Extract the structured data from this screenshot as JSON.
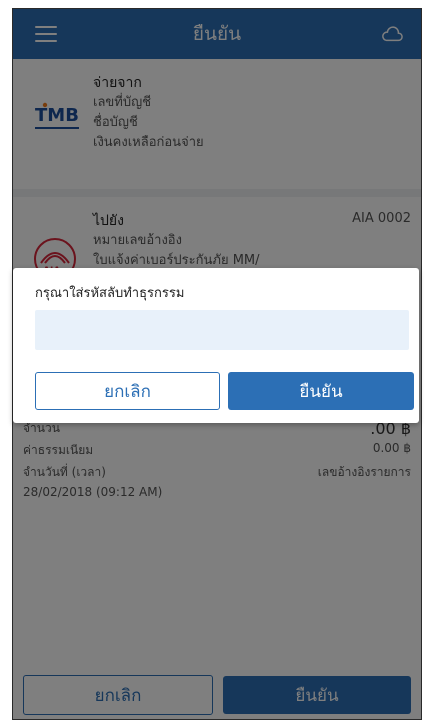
{
  "header": {
    "title": "ยืนยัน",
    "menu_icon": "menu-icon",
    "cloud_icon": "cloud-icon"
  },
  "from_section": {
    "title": "จ่ายจาก",
    "lines": [
      "เลขที่บัญชี",
      "ชื่อบัญชี",
      "เงินคงเหลือก่อนจ่าย"
    ],
    "logo_text": "TMB"
  },
  "to_section": {
    "title": "ไปยัง",
    "code": "AIA 0002",
    "lines": [
      "หมายเลขอ้างอิง",
      "ใบแจ้งค่าเบอร์ประกันภัย MM/"
    ]
  },
  "summary": {
    "rows": [
      {
        "label": "จำนวน",
        "value": ".00 ฿"
      },
      {
        "label": "ค่าธรรมเนียม",
        "value": "0.00 ฿"
      },
      {
        "label": "จำนวันที่ (เวลา)",
        "value": "เลขอ้างอิงรายการ"
      },
      {
        "label": "28/02/2018 (09:12 AM)",
        "value": ""
      }
    ]
  },
  "bottom_bar": {
    "cancel_label": "ยกเลิก",
    "confirm_label": "ยืนยัน"
  },
  "dialog": {
    "title": "กรุณาใส่รหัสลับทำธุรกรรม",
    "input_value": "",
    "cancel_label": "ยกเลิก",
    "confirm_label": "ยืนยัน"
  },
  "colors": {
    "brand": "#2c6fb5",
    "input_bg": "#e8f1fa"
  }
}
